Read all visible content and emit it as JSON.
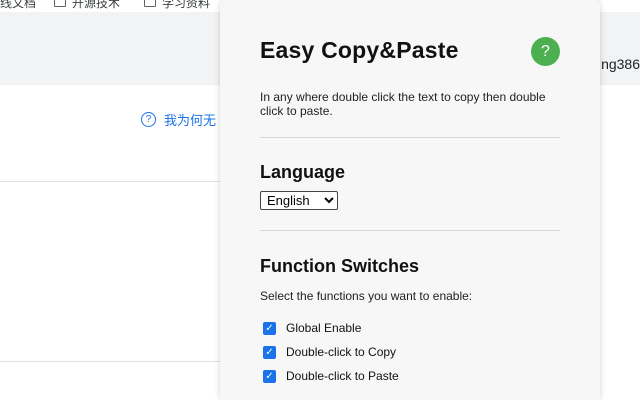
{
  "background": {
    "bookmarks": [
      {
        "label": "线文档"
      },
      {
        "label": "开源技术"
      },
      {
        "label": "学习资料"
      }
    ],
    "username_fragment": "ng386",
    "why_link_label": "我为何无"
  },
  "popup": {
    "title": "Easy Copy&Paste",
    "help_button_label": "?",
    "description": "In any where double click the text to copy then double click to paste.",
    "language": {
      "heading": "Language",
      "selected": "English",
      "options": [
        "English"
      ]
    },
    "functions": {
      "heading": "Function Switches",
      "subtext": "Select the functions you want to enable:",
      "switches": [
        {
          "label": "Global Enable",
          "checked": true
        },
        {
          "label": "Double-click to Copy",
          "checked": true
        },
        {
          "label": "Double-click to Paste",
          "checked": true
        }
      ]
    }
  },
  "colors": {
    "help_button": "#4caf50",
    "checkbox": "#1a73e8",
    "link": "#1a73e8"
  }
}
